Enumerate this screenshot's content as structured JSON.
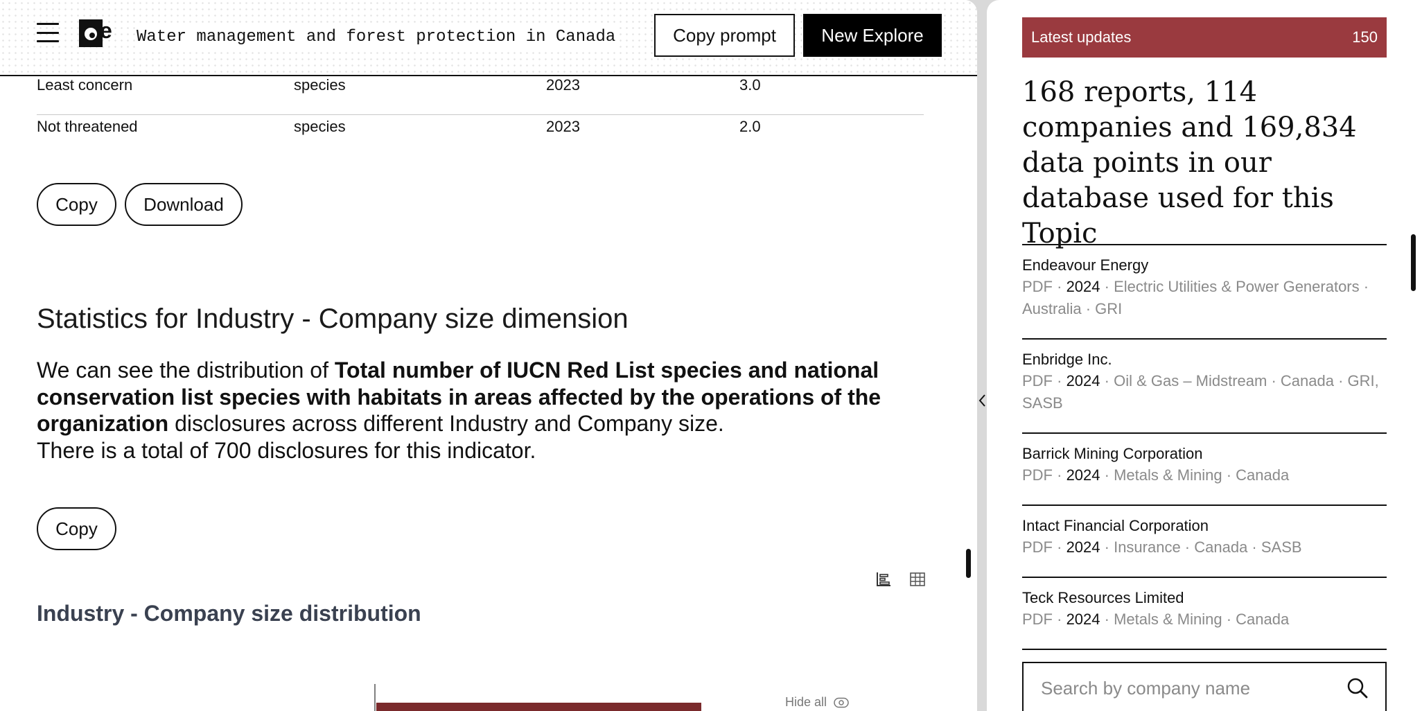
{
  "header": {
    "title": "Water management and forest protection in Canada",
    "copy_prompt_label": "Copy prompt",
    "new_explore_label": "New Explore"
  },
  "table": {
    "rows": [
      {
        "label": "Least concern",
        "unit": "species",
        "year": "2023",
        "value": "3.0"
      },
      {
        "label": "Not threatened",
        "unit": "species",
        "year": "2023",
        "value": "2.0"
      }
    ]
  },
  "table_actions": {
    "copy_label": "Copy",
    "download_label": "Download"
  },
  "statistics": {
    "title": "Statistics for Industry - Company size dimension",
    "intro": "We can see the distribution of ",
    "indicator": "Total number of IUCN Red List species and national conservation list species with habitats in areas affected by the operations of the organization",
    "after": " disclosures across different Industry and Company size.",
    "total_line": "There is a total of 700 disclosures for this indicator.",
    "copy_label": "Copy"
  },
  "chart": {
    "title": "Industry - Company size distribution",
    "hide_all_label": "Hide all",
    "bar_color": "#7a2a2c",
    "icons": [
      "bar-chart-icon",
      "table-icon"
    ]
  },
  "sidebar": {
    "latest_label": "Latest updates",
    "latest_count": "150",
    "headline": "168 reports, 114 companies and 169,834 data points in our database used for this Topic",
    "reports": [
      {
        "company": "Endeavour Energy",
        "format": "PDF",
        "year": "2024",
        "tags": "Electric Utilities & Power Generators · Australia · GRI"
      },
      {
        "company": "Enbridge Inc.",
        "format": "PDF",
        "year": "2024",
        "tags": "Oil & Gas – Midstream · Canada · GRI, SASB"
      },
      {
        "company": "Barrick Mining Corporation",
        "format": "PDF",
        "year": "2024",
        "tags": "Metals & Mining · Canada"
      },
      {
        "company": "Intact Financial Corporation",
        "format": "PDF",
        "year": "2024",
        "tags": "Insurance · Canada · SASB"
      },
      {
        "company": "Teck Resources Limited",
        "format": "PDF",
        "year": "2024",
        "tags": "Metals & Mining · Canada"
      }
    ],
    "search_placeholder": "Search by company name"
  },
  "colors": {
    "accent": "#9a3a3f",
    "text": "#111111",
    "muted": "#8a8a8a"
  }
}
